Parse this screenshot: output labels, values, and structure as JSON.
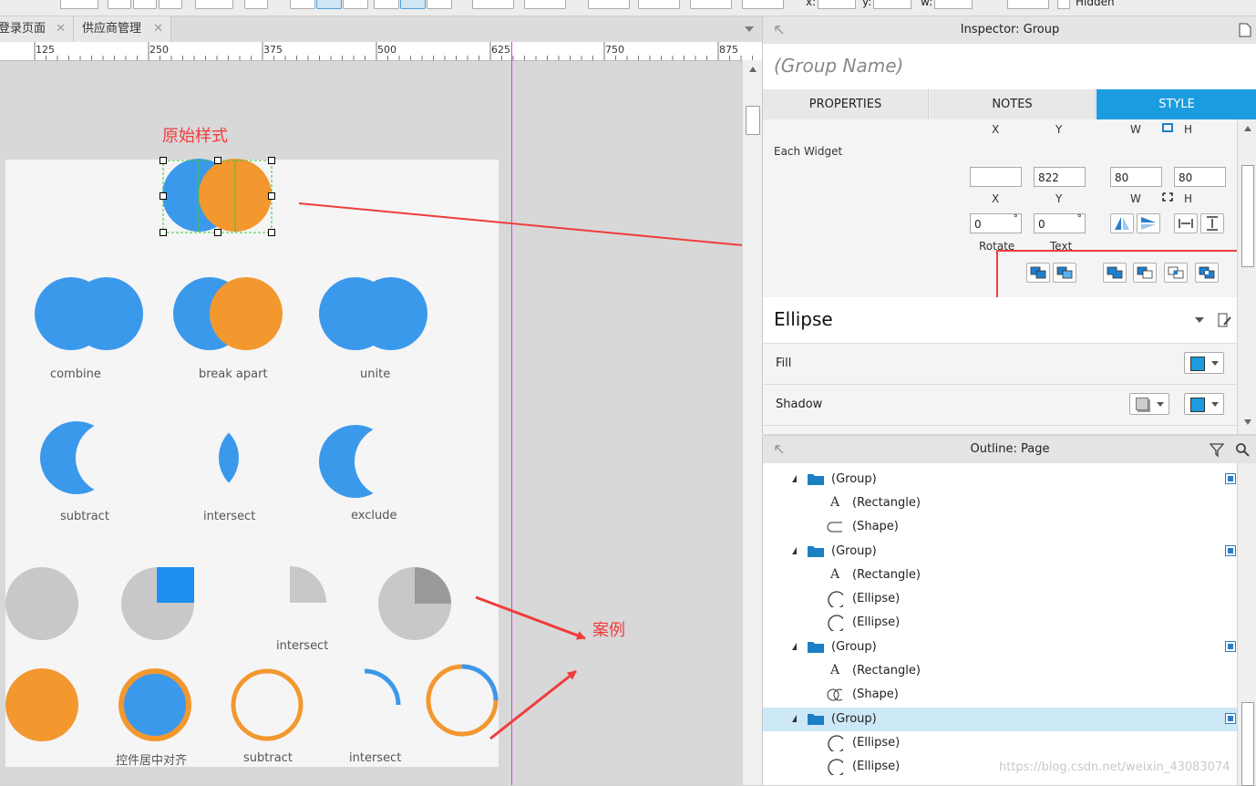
{
  "tabs": [
    {
      "label": "登录页面",
      "close": "✕"
    },
    {
      "label": "供应商管理",
      "close": "✕"
    }
  ],
  "toolbar": {
    "x_label": "x:",
    "y_label": "y:",
    "w_label": "w:",
    "hidden_label": "Hidden"
  },
  "ruler": [
    "125",
    "250",
    "375",
    "500",
    "625",
    "750",
    "875"
  ],
  "canvas": {
    "orig_caption": "原始样式",
    "case_caption": "案例",
    "labels": {
      "combine": "combine",
      "break_apart": "break apart",
      "unite": "unite",
      "subtract": "subtract",
      "intersect": "intersect",
      "exclude": "exclude",
      "intersect2": "intersect",
      "center_align": "控件居中对齐",
      "subtract2": "subtract",
      "intersect3": "intersect"
    },
    "colors": {
      "blue": "#3b99ec",
      "orange": "#f2982f",
      "gray": "#c8c8c8",
      "dark_gray": "#9a9a9a",
      "square_blue": "#1f8ef1",
      "arrow_red": "#f03c3c"
    }
  },
  "inspector": {
    "title": "Inspector: Group",
    "group_name_placeholder": "(Group Name)",
    "tabs": [
      {
        "label": "PROPERTIES"
      },
      {
        "label": "NOTES"
      },
      {
        "label": "STYLE"
      }
    ],
    "header_labels": {
      "x": "X",
      "y": "Y",
      "w": "W",
      "h": "H"
    },
    "each_widget": "Each Widget",
    "fields": {
      "x": "",
      "y": "822",
      "w": "80",
      "h": "80",
      "rotate": "0",
      "text_rotate": "0"
    },
    "degree": "°",
    "rotate_label": "Rotate",
    "text_label": "Text",
    "style_name": "Ellipse",
    "fill_label": "Fill",
    "shadow_label": "Shadow"
  },
  "outline": {
    "title": "Outline: Page",
    "rows": [
      {
        "type": "group",
        "label": "(Group)",
        "selected": false
      },
      {
        "type": "rect",
        "label": "(Rectangle)"
      },
      {
        "type": "shape",
        "label": "(Shape)"
      },
      {
        "type": "group",
        "label": "(Group)",
        "selected": false
      },
      {
        "type": "rect",
        "label": "(Rectangle)"
      },
      {
        "type": "ellipse",
        "label": "(Ellipse)"
      },
      {
        "type": "ellipse",
        "label": "(Ellipse)"
      },
      {
        "type": "group",
        "label": "(Group)",
        "selected": false
      },
      {
        "type": "rect",
        "label": "(Rectangle)"
      },
      {
        "type": "shape2",
        "label": "(Shape)"
      },
      {
        "type": "group",
        "label": "(Group)",
        "selected": true
      },
      {
        "type": "ellipse",
        "label": "(Ellipse)"
      },
      {
        "type": "ellipse",
        "label": "(Ellipse)"
      }
    ],
    "rect_glyph": "A"
  },
  "watermark": "https://blog.csdn.net/weixin_43083074"
}
